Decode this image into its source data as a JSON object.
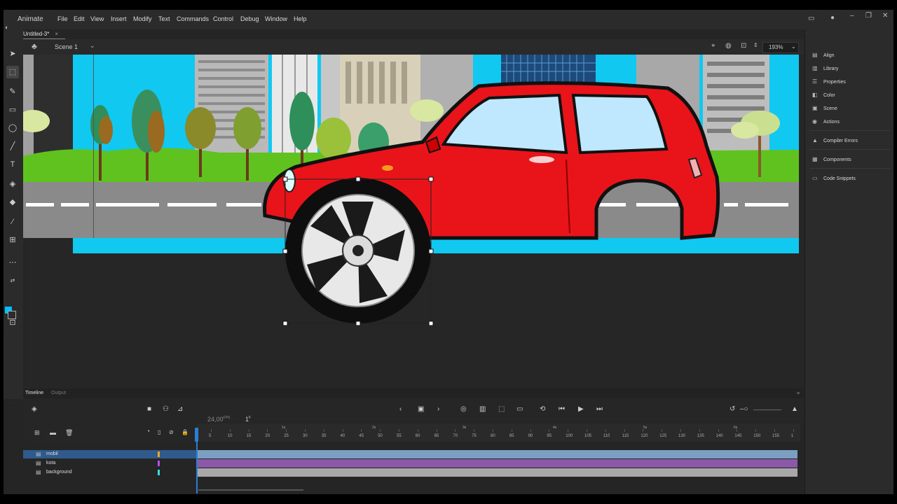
{
  "app": {
    "name": "Animate"
  },
  "menu": [
    "File",
    "Edit",
    "View",
    "Insert",
    "Modify",
    "Text",
    "Commands",
    "Control",
    "Debug",
    "Window",
    "Help"
  ],
  "document_tab": {
    "title": "Untitled-3*",
    "close": "×"
  },
  "scene": {
    "label": "Scene 1"
  },
  "zoom": {
    "value": "193%"
  },
  "right_panel": {
    "items": [
      {
        "label": "Align",
        "icon": "align-icon"
      },
      {
        "label": "Library",
        "icon": "library-icon"
      },
      {
        "label": "Properties",
        "icon": "properties-icon"
      },
      {
        "label": "Color",
        "icon": "color-icon"
      },
      {
        "label": "Scene",
        "icon": "scene-icon"
      },
      {
        "label": "Actions",
        "icon": "actions-icon"
      },
      {
        "label": "Compiler Errors",
        "icon": "warning-icon"
      },
      {
        "label": "Components",
        "icon": "components-icon"
      },
      {
        "label": "Code Snippets",
        "icon": "code-snippets-icon"
      }
    ]
  },
  "timeline": {
    "tabs": [
      "Timeline",
      "Output"
    ],
    "fps": "24,00",
    "fps_unit": "FPS",
    "current_frame": "1",
    "frame_unit": "F",
    "layers": [
      {
        "name": "mobil",
        "color": "#f5a623",
        "selected": true
      },
      {
        "name": "kota",
        "color": "#b84dff",
        "selected": false
      },
      {
        "name": "background",
        "color": "#33e0e0",
        "selected": false
      }
    ],
    "ruler_ticks": [
      "5",
      "10",
      "15",
      "20",
      "25",
      "30",
      "35",
      "40",
      "45",
      "50",
      "55",
      "60",
      "65",
      "70",
      "75",
      "80",
      "85",
      "90",
      "95",
      "100",
      "105",
      "110",
      "115",
      "120",
      "125",
      "130",
      "135",
      "140",
      "145",
      "150",
      "155",
      "1"
    ],
    "seconds_marks": [
      "1s",
      "2s",
      "3s",
      "4s",
      "5s",
      "6s"
    ]
  },
  "colors": {
    "accent": "#2a7fd4",
    "car_red": "#e8141a",
    "sky": "#10c8f0",
    "grass": "#5fc21e",
    "road": "#8a8a8a"
  }
}
